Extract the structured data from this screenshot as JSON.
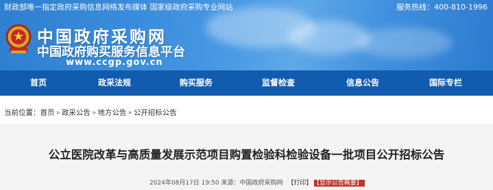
{
  "header": {
    "slogan": "财政部唯一指定政府采购信息网络发布媒体  国家级政府采购专业网站",
    "hotline": "服务热线：400-810-1996",
    "brand_title": "中国政府采购网",
    "brand_subtitle": "中国政府购买服务信息平台",
    "brand_url": "www.ccgp.gov.cn"
  },
  "nav": {
    "items": [
      "首页",
      "政采法规",
      "购买服务",
      "监督检查",
      "信息公告",
      "国际专栏"
    ]
  },
  "breadcrumb": {
    "prefix": "当前位置：",
    "items": [
      "首页",
      "政采公告",
      "地方公告",
      "公开招标公告"
    ]
  },
  "article": {
    "title": "公立医院改革与高质量发展示范项目购置检验科检验设备一批项目公开招标公告",
    "datetime": "2024年08月17日 19:50",
    "source_label": "来源：",
    "source": "中国政府采购网",
    "print_label": "【打印】",
    "summary_label": "【显示公告概要】"
  },
  "colors": {
    "nav_bg": "#115cae",
    "summary_bg": "#c2332b"
  }
}
